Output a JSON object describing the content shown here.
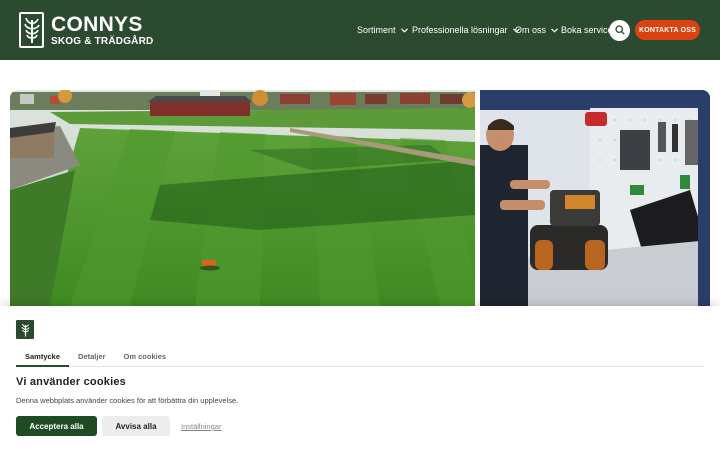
{
  "header": {
    "logo": {
      "line1": "CONNYS",
      "line2": "SKOG & TRÄDGÅRD",
      "icon": "tree-logo-icon"
    },
    "nav": [
      {
        "label": "Sortiment",
        "has_dropdown": true
      },
      {
        "label": "Professionella lösningar",
        "has_dropdown": true
      },
      {
        "label": "Om oss",
        "has_dropdown": true
      },
      {
        "label": "Boka service",
        "has_dropdown": false
      }
    ],
    "search_icon": "search-icon",
    "cta_label": "KONTAKTA OSS"
  },
  "hero": {
    "images": [
      {
        "name": "football-field-robot-mower-photo"
      },
      {
        "name": "technician-servicing-robot-mower-photo"
      }
    ]
  },
  "cookie_banner": {
    "tabs": [
      {
        "label": "Samtycke",
        "active": true
      },
      {
        "label": "Detaljer",
        "active": false
      },
      {
        "label": "Om cookies",
        "active": false
      }
    ],
    "title": "Vi använder cookies",
    "description": "Denna webbplats använder cookies för att förbättra din upplevelse.",
    "accept_label": "Acceptera alla",
    "reject_label": "Avvisa alla",
    "settings_label": "Inställningar"
  },
  "colors": {
    "header_bg": "#2c4a30",
    "cta_bg": "#d9430f",
    "accept_bg": "#1f4a23"
  }
}
